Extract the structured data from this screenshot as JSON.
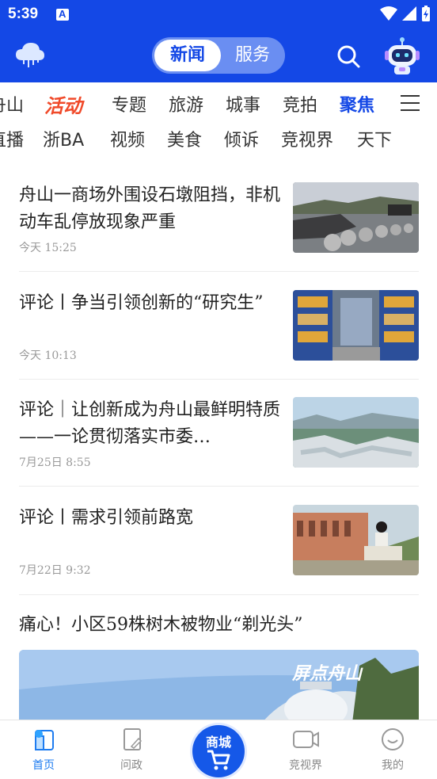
{
  "status_bar": {
    "time": "5:39"
  },
  "header": {
    "segment_active": "新闻",
    "segment_inactive": "服务",
    "colors": {
      "brand_blue": "#1448e6",
      "active_red": "#f04a2a"
    }
  },
  "tabs": {
    "row1": [
      "舟山",
      "活动",
      "专题",
      "旅游",
      "城事",
      "竞拍",
      "聚焦"
    ],
    "row2": [
      "直播",
      "浙BA",
      "视频",
      "美食",
      "倾诉",
      "竞视界",
      "天下"
    ],
    "active": "聚焦"
  },
  "feed": [
    {
      "title": "舟山一商场外围设石墩阻挡，非机动车乱停放现象严重",
      "time": "今天  15:25"
    },
    {
      "title": "评论丨争当引领创新的“研究生”",
      "time": "今天  10:13"
    },
    {
      "title": "评论｜让创新成为舟山最鲜明特质——一论贯彻落实市委…",
      "time": "7月25日  8:55"
    },
    {
      "title": "评论丨需求引领前路宽",
      "time": "7月22日  9:32"
    }
  ],
  "feature": {
    "title": "痛心！小区59株树木被物业“剃光头”",
    "watermark": "屏点舟山"
  },
  "bottom_nav": {
    "home": "首页",
    "politics": "问政",
    "shop": "商城",
    "video": "竞视界",
    "mine": "我的"
  }
}
